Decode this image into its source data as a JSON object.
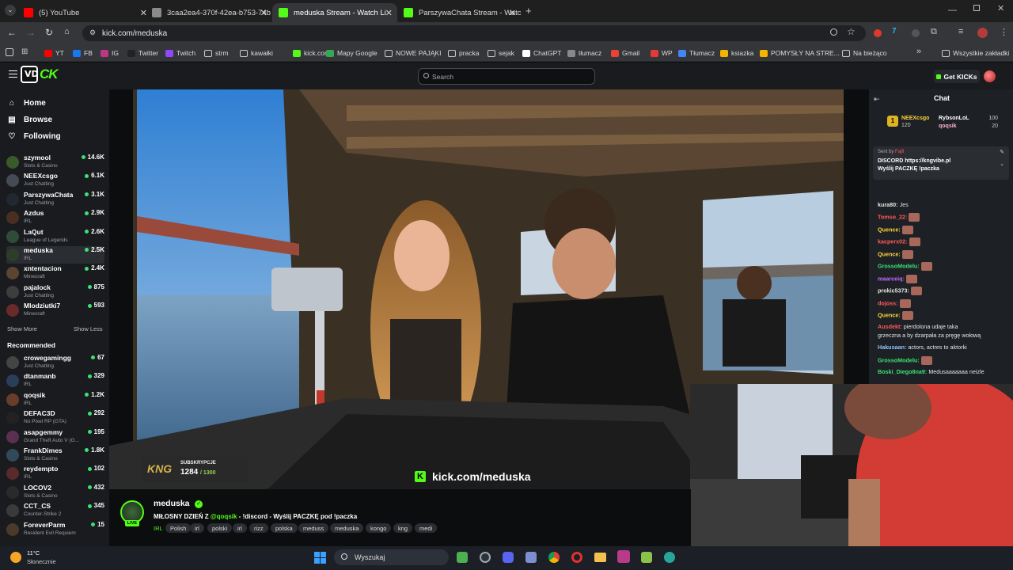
{
  "browser": {
    "tabs": [
      {
        "label": "(5) YouTube",
        "active": false,
        "favicon_color": "#ff0000"
      },
      {
        "label": "3caa2ea4-370f-42ea-b753-74b",
        "active": false,
        "favicon_color": "#8a8a8a"
      },
      {
        "label": "meduska Stream - Watch Li",
        "active": true,
        "favicon_color": "#53fc18"
      },
      {
        "label": "ParszywaChata Stream - Watch",
        "active": false,
        "favicon_color": "#53fc18"
      }
    ],
    "url": "kick.com/meduska",
    "bookmarks": [
      "YT",
      "FB",
      "IG",
      "Twitter",
      "Twitch",
      "strm",
      "kawałki",
      "kick.com",
      "Mapy Google",
      "NOWE PAJĄKI",
      "pracka",
      "sejak",
      "ChatGPT",
      "tłumacz",
      "Gmail",
      "WP",
      "Tłumacz",
      "ksiazka",
      "POMYSŁY NA STRE...",
      "Na bieżąco",
      "Wszystkie zakładki"
    ]
  },
  "header": {
    "search_placeholder": "Search",
    "get_kicks": "Get KICKs"
  },
  "sidebar": {
    "nav": [
      "Home",
      "Browse",
      "Following"
    ],
    "following": [
      {
        "name": "szymool",
        "game": "Slots & Casino",
        "viewers": "14.6K",
        "color": "#3a5a2a"
      },
      {
        "name": "NEEXcsgo",
        "game": "Just Chatting",
        "viewers": "6.1K",
        "color": "#444b55"
      },
      {
        "name": "ParszywaChata",
        "game": "Just Chatting",
        "viewers": "3.1K",
        "color": "#222831"
      },
      {
        "name": "Azdus",
        "game": "IRL",
        "viewers": "2.9K",
        "color": "#4a2e22"
      },
      {
        "name": "LaQut",
        "game": "League of Legends",
        "viewers": "2.6K",
        "color": "#2f4b3a"
      },
      {
        "name": "meduska",
        "game": "IRL",
        "viewers": "2.5K",
        "color": "#2e3d2a"
      },
      {
        "name": "xntentacion",
        "game": "Minecraft",
        "viewers": "2.4K",
        "color": "#5a4630"
      },
      {
        "name": "pajalock",
        "game": "Just Chatting",
        "viewers": "875",
        "color": "#3d3d3d"
      },
      {
        "name": "Mlodziutki7",
        "game": "Minecraft",
        "viewers": "593",
        "color": "#6a2a2a"
      }
    ],
    "show_more": "Show More",
    "show_less": "Show Less",
    "recommended_title": "Recommended",
    "recommended": [
      {
        "name": "crowegamingg",
        "game": "Just Chatting",
        "viewers": "67",
        "color": "#444"
      },
      {
        "name": "dtanmanb",
        "game": "IRL",
        "viewers": "329",
        "color": "#2c3d5a"
      },
      {
        "name": "qoqsik",
        "game": "IRL",
        "viewers": "1.2K",
        "color": "#6a3d2a"
      },
      {
        "name": "DEFAC3D",
        "game": "No Pixel RP (GTA)",
        "viewers": "292",
        "color": "#222"
      },
      {
        "name": "asapgemmy",
        "game": "Grand Theft Auto V (G...",
        "viewers": "195",
        "color": "#5a3050"
      },
      {
        "name": "FrankDimes",
        "game": "Slots & Casino",
        "viewers": "1.8K",
        "color": "#304a5a"
      },
      {
        "name": "reydempto",
        "game": "IRL",
        "viewers": "102",
        "color": "#5a2a2a"
      },
      {
        "name": "LOCOV2",
        "game": "Slots & Casino",
        "viewers": "432",
        "color": "#2a2a2a"
      },
      {
        "name": "CCT_CS",
        "game": "Counter-Strike 2",
        "viewers": "345",
        "color": "#3a3a3a"
      },
      {
        "name": "ForeverParm",
        "game": "Resident Evil Requiem",
        "viewers": "15",
        "color": "#4a3a2a"
      }
    ]
  },
  "video": {
    "subs_label": "SUBSKRYPCJE",
    "subs_count": "1284",
    "subs_goal": "/ 1300",
    "watermark": "kick.com/meduska"
  },
  "stream": {
    "streamer": "meduska",
    "title_pre": "MIŁOSNY DZIEŃ Z ",
    "title_mention": "@qoqsik",
    "title_post": " - !discord - Wyślij PACZKĘ pod !paczka",
    "live": "LIVE",
    "tags": [
      "IRL",
      "Polish",
      "irl",
      "polski",
      "irl",
      "rizz",
      "polska",
      "meduss",
      "meduska",
      "kongo",
      "kng",
      "medi"
    ]
  },
  "chat": {
    "title": "Chat",
    "top_gifters": [
      {
        "name": "NEEXcsgo",
        "amount": "120"
      },
      {
        "name": "RybsonLoL",
        "amount": "100"
      },
      {
        "name": "qoqsik",
        "amount": "20"
      }
    ],
    "pinned_sender": "Sent by",
    "pinned_text": "DISCORD https://kngvibe.pl",
    "pinned_text2": "Wyślij PACZKĘ !paczka",
    "messages": [
      {
        "user": "kura80",
        "text": "Jes",
        "color": "#e6e6e6"
      },
      {
        "user": "Tomso_22",
        "text": "",
        "color": "#ff5a5a"
      },
      {
        "user": "Quence",
        "text": "",
        "color": "#ffd23a"
      },
      {
        "user": "kacperx02",
        "text": "",
        "color": "#ff5a5a"
      },
      {
        "user": "Quence",
        "text": "",
        "color": "#ffd23a"
      },
      {
        "user": "GrossoModelu",
        "text": "",
        "color": "#3ae374"
      },
      {
        "user": "maarceiq",
        "text": "",
        "color": "#c46aff"
      },
      {
        "user": "prokic5373",
        "text": "",
        "color": "#e6e6e6"
      },
      {
        "user": "dojoss",
        "text": "",
        "color": "#ff5a5a"
      },
      {
        "user": "Quence",
        "text": "",
        "color": "#ffd23a"
      },
      {
        "user": "Ausdekt",
        "text": "pierdolona udaje taka",
        "color": "#ff5a5a"
      },
      {
        "user": "",
        "text": "grzeczna a by dzarpała za pręgę wołową",
        "color": "#e6e6e6"
      },
      {
        "user": "Hakusaan",
        "text": "actors, actres to aktorki",
        "color": "#8ec5ff"
      },
      {
        "user": "GrossoModelu",
        "text": "",
        "color": "#3ae374"
      },
      {
        "user": "Boski_Diego8na9",
        "text": "Medusaaaaaaa neizle",
        "color": "#3ae374"
      }
    ]
  },
  "taskbar": {
    "weather_temp": "11°C",
    "weather_desc": "Słonecznie",
    "search_placeholder": "Wyszukaj"
  }
}
